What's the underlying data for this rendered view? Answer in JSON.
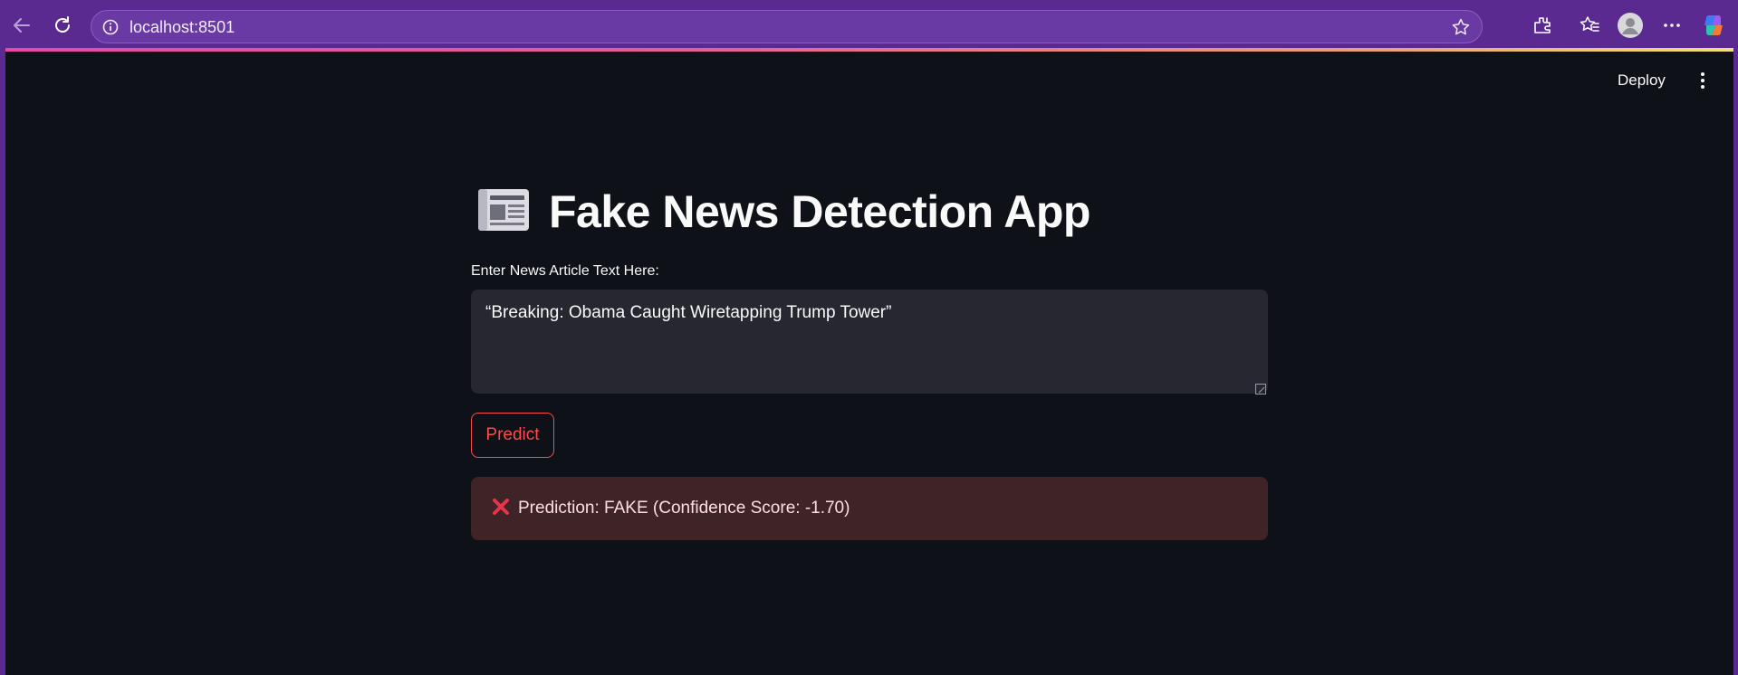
{
  "browser": {
    "url": "localhost:8501",
    "icons": [
      "back-icon",
      "refresh-icon",
      "info-icon",
      "star-icon",
      "extensions-icon",
      "favorites-icon",
      "profile-icon",
      "more-icon",
      "copilot-icon"
    ]
  },
  "header": {
    "deploy_label": "Deploy",
    "menu_icon": "kebab-menu-icon"
  },
  "main": {
    "title_icon": "newspaper-icon",
    "title": "Fake News Detection App",
    "input_label": "Enter News Article Text Here:",
    "input_value": "“Breaking: Obama Caught Wiretapping Trump Tower”",
    "predict_label": "Predict",
    "result": {
      "icon": "cross-mark-icon",
      "text": "Prediction: FAKE (Confidence Score: -1.70)"
    }
  },
  "colors": {
    "chrome": "#5a2a91",
    "app_background": "#0e1117",
    "input_background": "#262730",
    "accent": "#ff4b4b",
    "error_background": "#3e2327",
    "error_text": "#ffdede"
  }
}
